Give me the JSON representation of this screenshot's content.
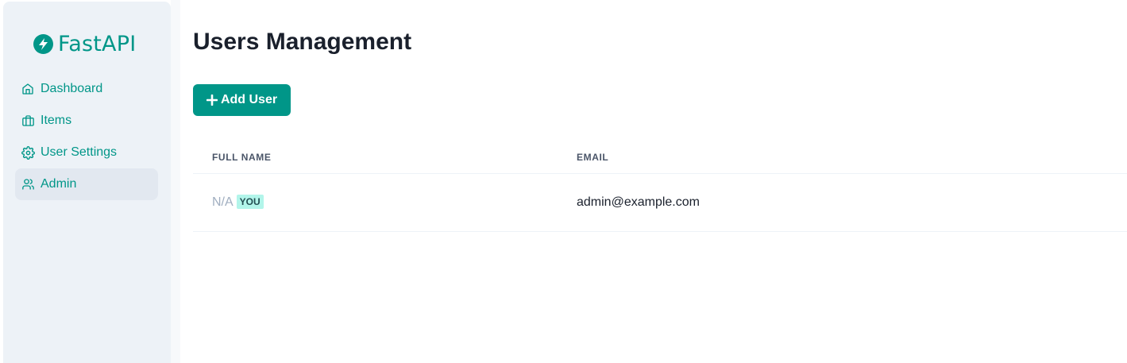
{
  "brand": {
    "name": "FastAPI",
    "color": "#009688"
  },
  "sidebar": {
    "items": [
      {
        "label": "Dashboard",
        "icon": "home-icon",
        "active": false
      },
      {
        "label": "Items",
        "icon": "briefcase-icon",
        "active": false
      },
      {
        "label": "User Settings",
        "icon": "gear-icon",
        "active": false
      },
      {
        "label": "Admin",
        "icon": "users-icon",
        "active": true
      }
    ]
  },
  "main": {
    "title": "Users Management",
    "add_button_label": "Add User",
    "table": {
      "columns": [
        "FULL NAME",
        "EMAIL"
      ],
      "rows": [
        {
          "full_name": "N/A",
          "badge": "YOU",
          "email": "admin@example.com"
        }
      ]
    }
  }
}
